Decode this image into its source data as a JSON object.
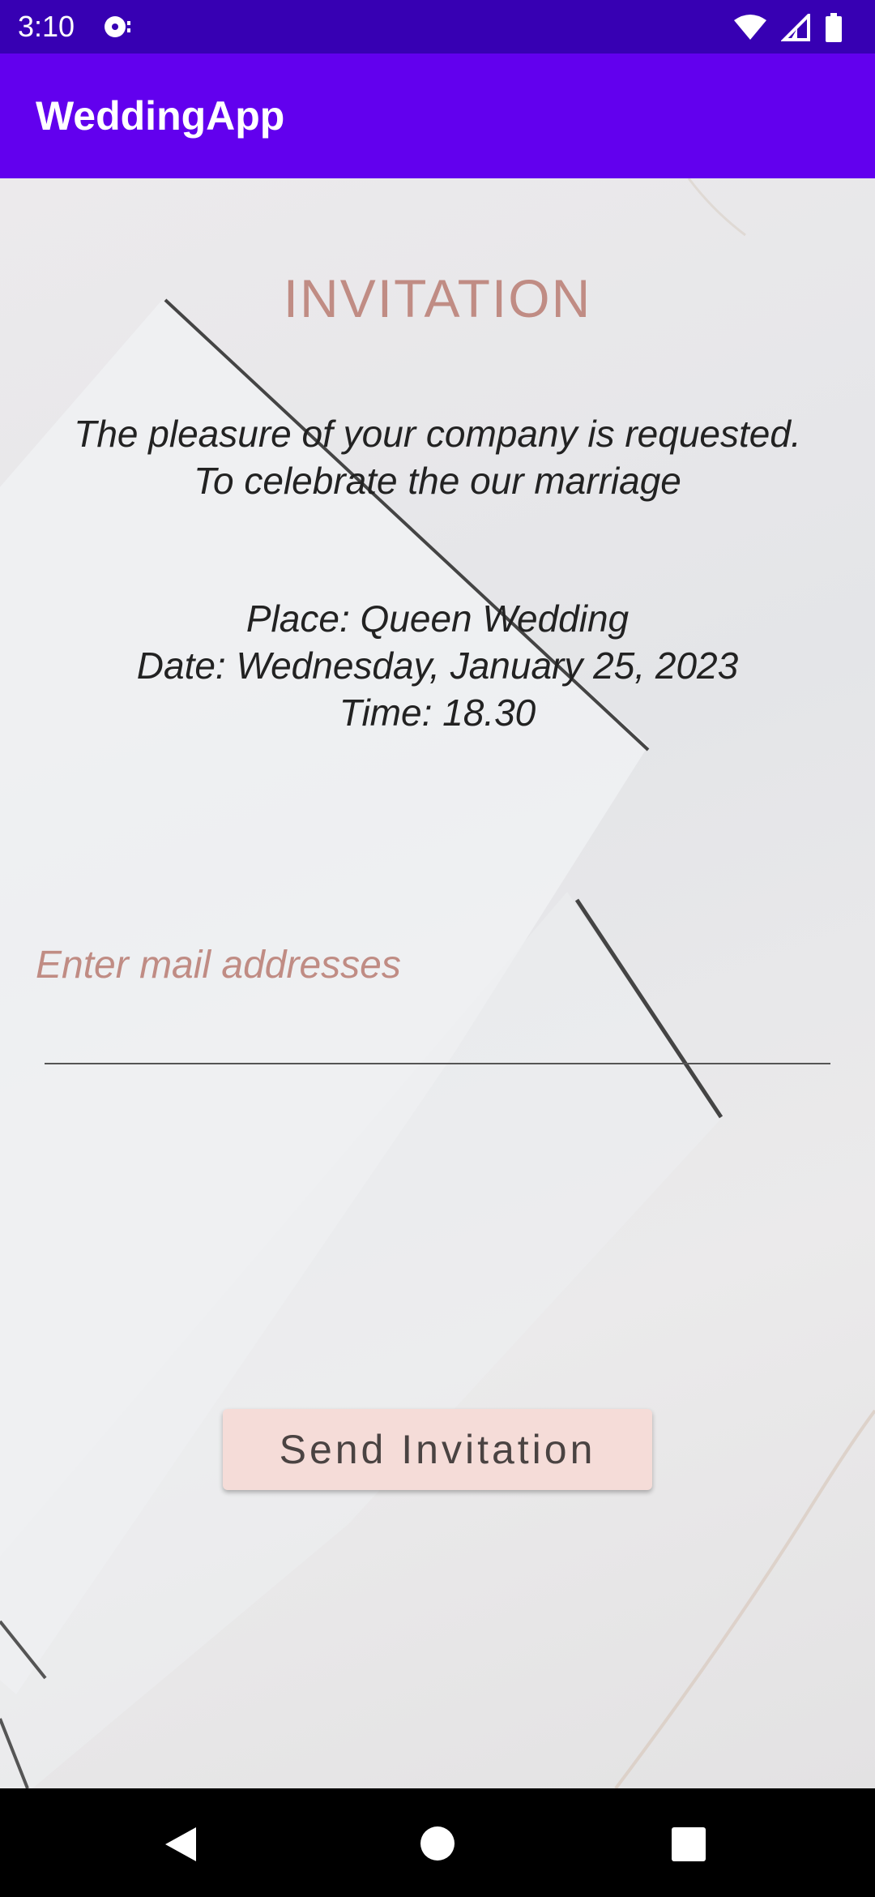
{
  "status_bar": {
    "time": "3:10",
    "icons": [
      "media-icon",
      "wifi-icon",
      "signal-icon",
      "battery-icon"
    ]
  },
  "app_bar": {
    "title": "WeddingApp",
    "color": "#6200ee",
    "status_color": "#3700b3"
  },
  "invitation": {
    "title": "INVITATION",
    "message_lines": [
      "The pleasure of your company is requested.",
      "To celebrate the our marriage"
    ],
    "details": {
      "place": "Place: Queen Wedding",
      "date": "Date: Wednesday, January 25, 2023",
      "time": "Time: 18.30"
    },
    "accent_color": "#c08c84"
  },
  "email": {
    "placeholder": "Enter mail addresses",
    "value": ""
  },
  "send_button": {
    "label": "Send Invitation",
    "color": "#f5dcd8"
  },
  "nav_bar": {
    "icons": [
      "back-icon",
      "home-icon",
      "recents-icon"
    ]
  }
}
